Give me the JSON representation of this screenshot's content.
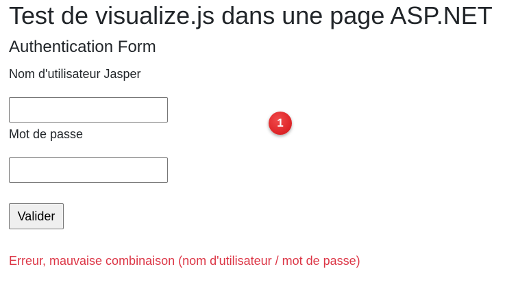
{
  "page": {
    "title": "Test de visualize.js dans une page ASP.NET"
  },
  "form": {
    "title": "Authentication Form",
    "username_label": "Nom d'utilisateur Jasper",
    "username_value": "",
    "password_label": "Mot de passe",
    "password_value": "",
    "submit_label": "Valider",
    "error_message": "Erreur, mauvaise combinaison (nom d'utilisateur / mot de passe)"
  },
  "annotation": {
    "step_number": "1"
  },
  "colors": {
    "text": "#212529",
    "error": "#dc3545",
    "marker": "#e0282b"
  }
}
